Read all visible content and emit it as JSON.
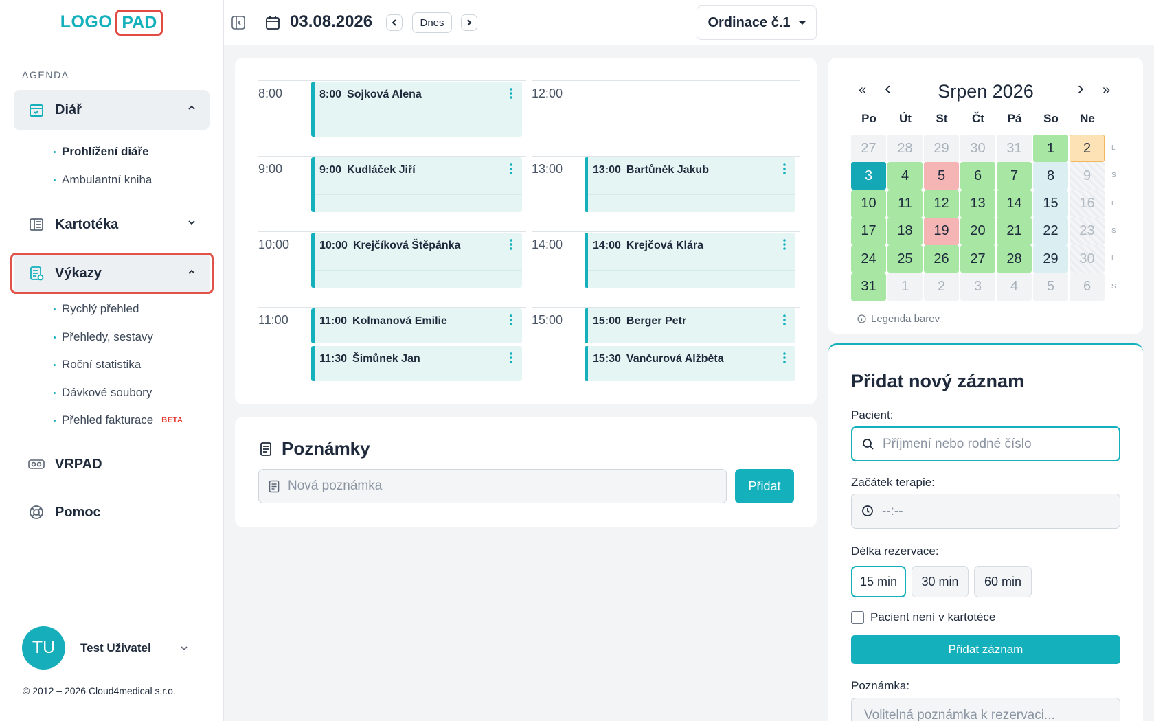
{
  "logo": {
    "part1": "LOGO",
    "part2": "PAD"
  },
  "sidebar": {
    "section_title": "AGENDA",
    "diar": {
      "label": "Diář",
      "sub": [
        "Prohlížení diáře",
        "Ambulantní kniha"
      ]
    },
    "kartoteka": {
      "label": "Kartotéka"
    },
    "vykazy": {
      "label": "Výkazy",
      "sub": [
        "Rychlý přehled",
        "Přehledy, sestavy",
        "Roční statistika",
        "Dávkové soubory",
        "Přehled fakturace"
      ],
      "beta": "BETA"
    },
    "vrpad": {
      "label": "VRPAD"
    },
    "pomoc": {
      "label": "Pomoc"
    },
    "user": {
      "initials": "TU",
      "name": "Test Uživatel"
    },
    "copyright": "© 2012 – 2026 Cloud4medical s.r.o."
  },
  "topbar": {
    "date": "03.08.2026",
    "today": "Dnes",
    "office": "Ordinace č.1"
  },
  "schedule": {
    "left": [
      {
        "hour": "8:00",
        "appts": [
          {
            "time": "8:00",
            "name": "Sojková Alena"
          }
        ]
      },
      {
        "hour": "9:00",
        "appts": [
          {
            "time": "9:00",
            "name": "Kudláček Jiří"
          }
        ]
      },
      {
        "hour": "10:00",
        "appts": [
          {
            "time": "10:00",
            "name": "Krejčíková Štěpánka"
          }
        ]
      },
      {
        "hour": "11:00",
        "appts": [
          {
            "time": "11:00",
            "name": "Kolmanová Emilie"
          },
          {
            "time": "11:30",
            "name": "Šimůnek Jan"
          }
        ]
      }
    ],
    "right": [
      {
        "hour": "12:00",
        "appts": []
      },
      {
        "hour": "13:00",
        "appts": [
          {
            "time": "13:00",
            "name": "Bartůněk Jakub"
          }
        ]
      },
      {
        "hour": "14:00",
        "appts": [
          {
            "time": "14:00",
            "name": "Krejčová Klára"
          }
        ]
      },
      {
        "hour": "15:00",
        "appts": [
          {
            "time": "15:00",
            "name": "Berger Petr"
          },
          {
            "time": "15:30",
            "name": "Vančurová Alžběta"
          }
        ]
      }
    ]
  },
  "notes": {
    "title": "Poznámky",
    "placeholder": "Nová poznámka",
    "button": "Přidat"
  },
  "calendar": {
    "title": "Srpen 2026",
    "nav": {
      "prev_year": "«",
      "prev": "‹",
      "next": "›",
      "next_year": "»"
    },
    "weekdays": [
      "Po",
      "Út",
      "St",
      "Čt",
      "Pá",
      "So",
      "Ne"
    ],
    "weeks": [
      {
        "week_tag": "L",
        "days": [
          {
            "d": "27",
            "s": "out"
          },
          {
            "d": "28",
            "s": "out"
          },
          {
            "d": "29",
            "s": "out"
          },
          {
            "d": "30",
            "s": "out"
          },
          {
            "d": "31",
            "s": "out"
          },
          {
            "d": "1",
            "s": "green"
          },
          {
            "d": "2",
            "s": "orange"
          }
        ]
      },
      {
        "week_tag": "S",
        "days": [
          {
            "d": "3",
            "s": "today"
          },
          {
            "d": "4",
            "s": "green"
          },
          {
            "d": "5",
            "s": "red"
          },
          {
            "d": "6",
            "s": "green"
          },
          {
            "d": "7",
            "s": "green"
          },
          {
            "d": "8",
            "s": "blue"
          },
          {
            "d": "9",
            "s": "closed"
          }
        ]
      },
      {
        "week_tag": "L",
        "days": [
          {
            "d": "10",
            "s": "green"
          },
          {
            "d": "11",
            "s": "green"
          },
          {
            "d": "12",
            "s": "green"
          },
          {
            "d": "13",
            "s": "green"
          },
          {
            "d": "14",
            "s": "green"
          },
          {
            "d": "15",
            "s": "blue"
          },
          {
            "d": "16",
            "s": "closed"
          }
        ]
      },
      {
        "week_tag": "S",
        "days": [
          {
            "d": "17",
            "s": "green"
          },
          {
            "d": "18",
            "s": "green"
          },
          {
            "d": "19",
            "s": "red"
          },
          {
            "d": "20",
            "s": "green"
          },
          {
            "d": "21",
            "s": "green"
          },
          {
            "d": "22",
            "s": "blue"
          },
          {
            "d": "23",
            "s": "closed"
          }
        ]
      },
      {
        "week_tag": "L",
        "days": [
          {
            "d": "24",
            "s": "green"
          },
          {
            "d": "25",
            "s": "green"
          },
          {
            "d": "26",
            "s": "green"
          },
          {
            "d": "27",
            "s": "green"
          },
          {
            "d": "28",
            "s": "green"
          },
          {
            "d": "29",
            "s": "blue"
          },
          {
            "d": "30",
            "s": "closed"
          }
        ]
      },
      {
        "week_tag": "S",
        "days": [
          {
            "d": "31",
            "s": "green"
          },
          {
            "d": "1",
            "s": "out"
          },
          {
            "d": "2",
            "s": "out"
          },
          {
            "d": "3",
            "s": "out"
          },
          {
            "d": "4",
            "s": "out"
          },
          {
            "d": "5",
            "s": "out"
          },
          {
            "d": "6",
            "s": "out"
          }
        ]
      }
    ],
    "legend": "Legenda barev"
  },
  "form": {
    "title": "Přidat nový záznam",
    "patient_label": "Pacient:",
    "patient_placeholder": "Příjmení nebo rodné číslo",
    "start_label": "Začátek terapie:",
    "start_value": "--:--",
    "duration_label": "Délka rezervace:",
    "durations": [
      "15 min",
      "30 min",
      "60 min"
    ],
    "selected_duration": "15 min",
    "not_in_registry": "Pacient není v kartotéce",
    "submit": "Přidat záznam",
    "note_label": "Poznámka:",
    "note_placeholder": "Volitelná poznámka k rezervaci..."
  },
  "colors": {
    "accent": "#14b1bd",
    "highlight": "#e05248",
    "green": "#a8e6a4",
    "red": "#f5b5b5",
    "blue": "#dbeef2",
    "orange": "#fde2b5",
    "today": "#14a7b5"
  }
}
